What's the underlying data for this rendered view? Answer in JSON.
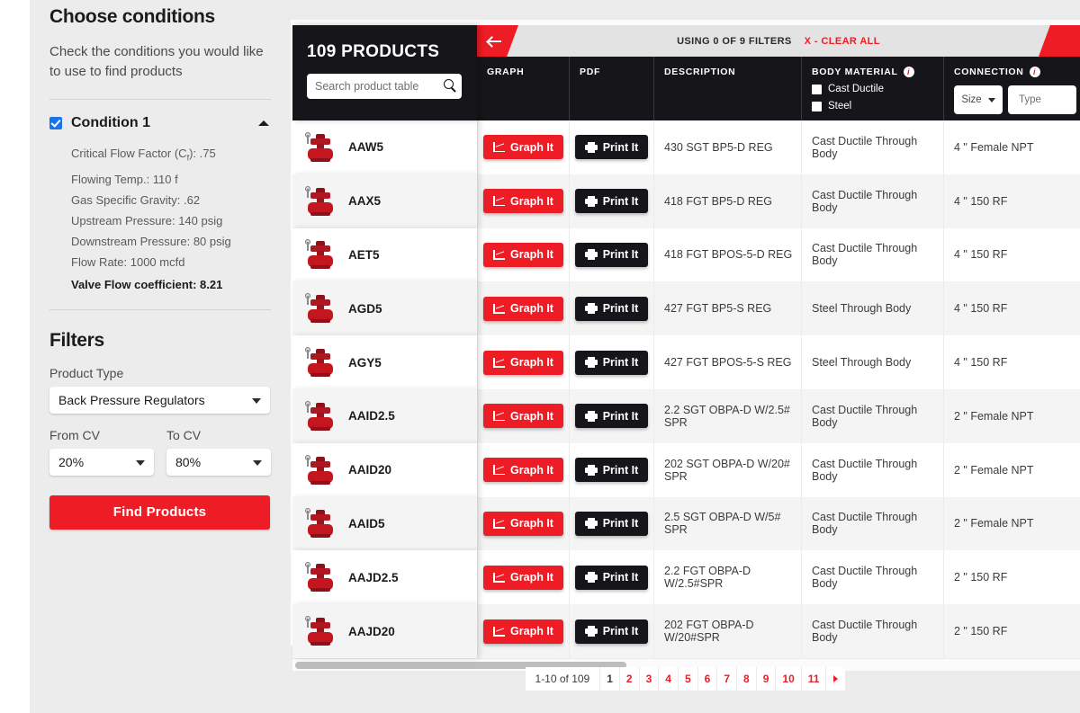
{
  "sidebar": {
    "title": "Choose conditions",
    "subtitle": "Check the conditions you would like to use to find products",
    "condition": {
      "label": "Condition 1",
      "checked": true,
      "items": [
        "Critical Flow Factor (Cƒ): .75",
        "Flowing Temp.: 110 f",
        "Gas Specific Gravity: .62",
        "Upstream Pressure: 140 psig",
        "Downstream Pressure: 80 psig",
        "Flow Rate: 1000 mcfd"
      ],
      "summary": "Valve Flow coefficient: 8.21"
    },
    "filters": {
      "title": "Filters",
      "product_type_label": "Product Type",
      "product_type_value": "Back Pressure Regulators",
      "from_cv_label": "From CV",
      "from_cv_value": "20%",
      "to_cv_label": "To CV",
      "to_cv_value": "80%",
      "find_button": "Find Products"
    }
  },
  "results": {
    "product_count": "109 PRODUCTS",
    "search_placeholder": "Search product table",
    "search_value": "",
    "filters_status": "USING 0 OF 9 FILTERS",
    "clear_all": "X - CLEAR ALL",
    "prev_label": "←",
    "next_label": "→",
    "columns": {
      "graph": "GRAPH",
      "pdf": "PDF",
      "description": "DESCRIPTION",
      "body_material": "BODY MATERIAL",
      "connection": "CONNECTION"
    },
    "body_material_options": [
      {
        "label": "Cast Ductile",
        "checked": false
      },
      {
        "label": "Steel",
        "checked": false
      }
    ],
    "connection_controls": {
      "size_label": "Size",
      "type_placeholder": "Type"
    },
    "graph_button": "Graph It",
    "print_button": "Print It",
    "rows": [
      {
        "name": "AAW5",
        "description": "430 SGT BP5-D REG",
        "body_material": "Cast Ductile Through Body",
        "connection": "4 \" Female NPT"
      },
      {
        "name": "AAX5",
        "description": "418 FGT BP5-D REG",
        "body_material": "Cast Ductile Through Body",
        "connection": "4 \" 150 RF"
      },
      {
        "name": "AET5",
        "description": "418 FGT BPOS-5-D REG",
        "body_material": "Cast Ductile Through Body",
        "connection": "4 \" 150 RF"
      },
      {
        "name": "AGD5",
        "description": "427 FGT BP5-S REG",
        "body_material": "Steel Through Body",
        "connection": "4 \" 150 RF"
      },
      {
        "name": "AGY5",
        "description": "427 FGT BPOS-5-S REG",
        "body_material": "Steel Through Body",
        "connection": "4 \" 150 RF"
      },
      {
        "name": "AAID2.5",
        "description": "2.2 SGT OBPA-D W/2.5# SPR",
        "body_material": "Cast Ductile Through Body",
        "connection": "2 \" Female NPT"
      },
      {
        "name": "AAID20",
        "description": "202 SGT OBPA-D W/20# SPR",
        "body_material": "Cast Ductile Through Body",
        "connection": "2 \" Female NPT"
      },
      {
        "name": "AAID5",
        "description": "2.5 SGT OBPA-D W/5# SPR",
        "body_material": "Cast Ductile Through Body",
        "connection": "2 \" Female NPT"
      },
      {
        "name": "AAJD2.5",
        "description": "2.2 FGT OBPA-D W/2.5#SPR",
        "body_material": "Cast Ductile Through Body",
        "connection": "2 \" 150 RF"
      },
      {
        "name": "AAJD20",
        "description": "202 FGT OBPA-D W/20#SPR",
        "body_material": "Cast Ductile Through Body",
        "connection": "2 \" 150 RF"
      }
    ],
    "pagination": {
      "range": "1-10 of 109",
      "pages": [
        "1",
        "2",
        "3",
        "4",
        "5",
        "6",
        "7",
        "8",
        "9",
        "10",
        "11"
      ],
      "current": "1",
      "next": "▸"
    }
  },
  "colors": {
    "accent_red": "#ee1c25",
    "dark": "#16161a",
    "sidebar_bg": "#ececec"
  }
}
